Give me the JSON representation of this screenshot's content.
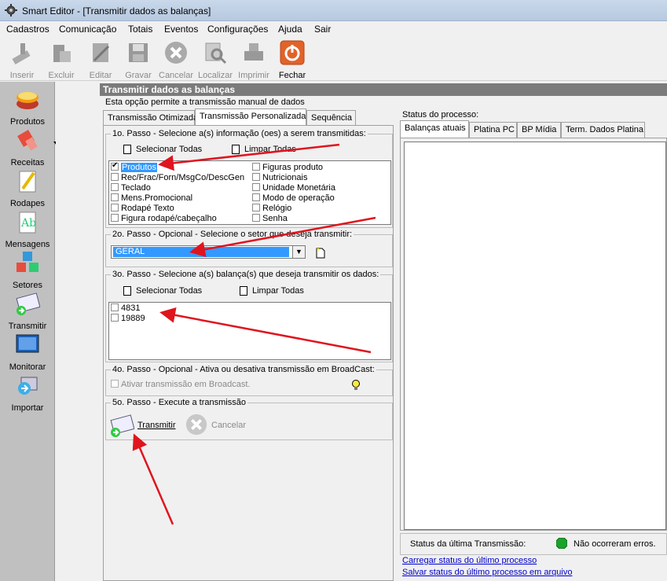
{
  "window": {
    "title": "Smart Editor  - [Transmitir dados as balanças]"
  },
  "menu": [
    "Cadastros",
    "Comunicação",
    "Totais",
    "Eventos",
    "Configurações",
    "Ajuda",
    "Sair"
  ],
  "toolbar": {
    "inserir": "Inserir",
    "excluir": "Excluir",
    "editar": "Editar",
    "gravar": "Gravar",
    "cancelar": "Cancelar",
    "localizar": "Localizar",
    "imprimir": "Imprimir",
    "fechar": "Fechar"
  },
  "sidebar": {
    "produtos": "Produtos",
    "receitas": "Receitas",
    "rodapes": "Rodapes",
    "mensagens": "Mensagens",
    "setores": "Setores",
    "transmitir": "Transmitir",
    "monitorar": "Monitorar",
    "importar": "Importar"
  },
  "header": {
    "title": "Transmitir dados as balanças",
    "description": "Esta opção permite a transmissão manual de dados"
  },
  "tabs": [
    "Transmissão Otimizada",
    "Transmissão Personalizada",
    "Sequência"
  ],
  "step1": {
    "title": "1o. Passo - Selecione a(s) informação (oes) a serem transmitidas:",
    "select_all": "Selecionar Todas",
    "clear_all": "Limpar Todas",
    "left": [
      "Produtos",
      "Rec/Frac/Forn/MsgCo/DescGen",
      "Teclado",
      "Mens.Promocional",
      "Rodapé Texto",
      "Figura rodapé/cabeçalho"
    ],
    "right": [
      "Figuras produto",
      "Nutricionais",
      "Unidade Monetária",
      "Modo de operação",
      "Relógio",
      "Senha"
    ]
  },
  "step2": {
    "title": "2o. Passo - Opcional - Selecione o setor que deseja transmitir:",
    "value": "GERAL"
  },
  "step3": {
    "title": "3o. Passo - Selecione a(s) balança(s) que deseja transmitir os dados:",
    "select_all": "Selecionar Todas",
    "clear_all": "Limpar Todas",
    "scales": [
      "4831",
      "19889"
    ]
  },
  "step4": {
    "title": "4o. Passo - Opcional - Ativa ou desativa transmissão em BroadCast:",
    "checkbox": "Ativar transmissão em Broadcast."
  },
  "step5": {
    "title": "5o. Passo - Execute a transmissão",
    "transmit": "Transmitir",
    "cancel": "Cancelar"
  },
  "status": {
    "title": "Status do processo:",
    "tabs": [
      "Balanças atuais",
      "Platina PC",
      "BP Mídia",
      "Term. Dados Platina"
    ],
    "last_label": "Status da última Transmissão:",
    "last_value": "Não ocorreram erros.",
    "link_load": "Carregar status do último processo",
    "link_save": "Salvar status do último processo em arquivo"
  },
  "colors": {
    "selection": "#3399ff",
    "status_ok": "#1aa32a",
    "arrow": "#e0141e"
  }
}
